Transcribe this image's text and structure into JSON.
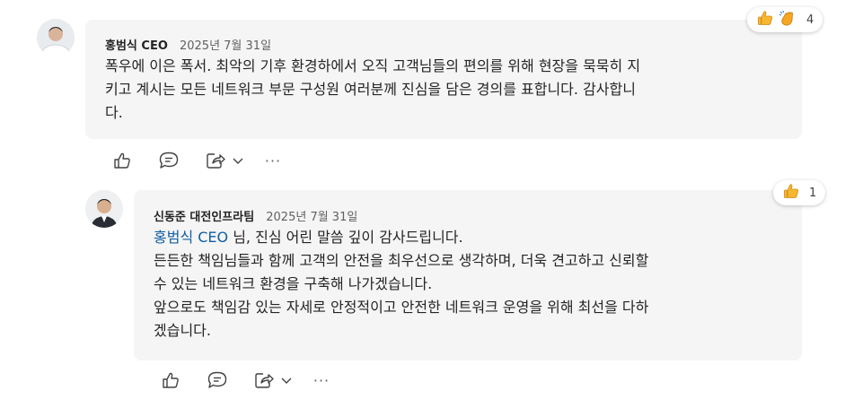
{
  "comment1": {
    "author": "홍범식 CEO",
    "date": "2025년 7월 31일",
    "lines": [
      "폭우에 이은 폭서. 최악의 기후 환경하에서 오직 고객님들의 편의를 위해 현장을 묵묵히 지",
      "키고 계시는 모든 네트워크 부문 구성원 여러분께 진심을 담은 경의를 표합니다. 감사합니",
      "다."
    ],
    "reaction_count": "4"
  },
  "comment2": {
    "author": "신동준 대전인프라팀",
    "date": "2025년 7월 31일",
    "mention": "홍범식 CEO",
    "first_line_rest": " 님, 진심 어린 말씀 깊이 감사드립니다.",
    "lines": [
      "든든한 책임님들과 함께 고객의 안전을 최우선으로 생각하며, 더욱 견고하고 신뢰할",
      "수 있는 네트워크 환경을 구축해 나가겠습니다.",
      "앞으로도 책임감 있는 자세로 안정적이고 안전한 네트워크 운영을 위해 최선을 다하",
      "겠습니다."
    ],
    "reaction_count": "1"
  },
  "actions": {
    "more": "···"
  },
  "colors": {
    "bubble": "#f5f5f5",
    "mention": "#115ea3",
    "thumbs": "#f7b732",
    "clap": "#f5a623"
  }
}
